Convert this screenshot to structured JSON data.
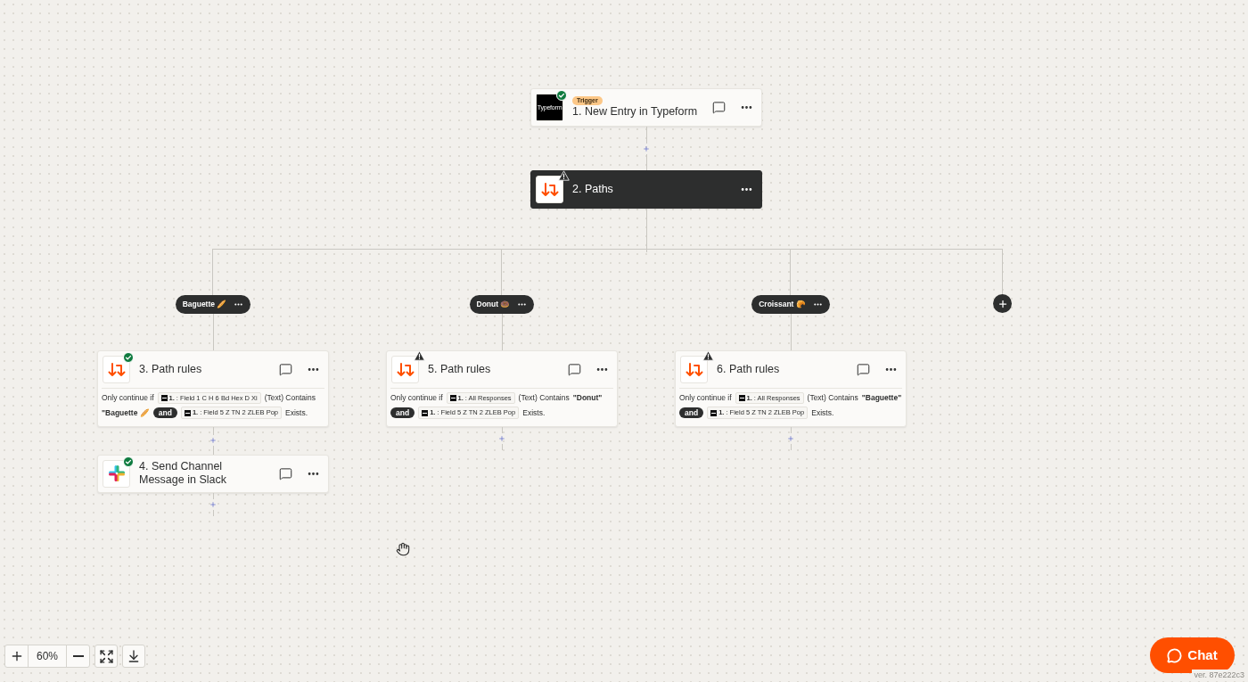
{
  "trigger": {
    "badge": "Trigger",
    "title": "1. New Entry in Typeform",
    "kind": "typeform",
    "logo_text": "Typeform",
    "complete": true,
    "selected": false
  },
  "paths_step": {
    "title": "2. Paths",
    "kind": "paths",
    "complete": false,
    "selected": true
  },
  "branches": [
    {
      "label": "Baguette 🥖",
      "steps": [
        {
          "title": "3. Path rules",
          "kind": "paths",
          "complete": true,
          "selected": false,
          "rule": [
            {
              "kind": "text",
              "text": "Only continue if"
            },
            {
              "kind": "field",
              "num": "1.",
              "text": ": Field 1 C H 6 Bd Hex D Xi"
            },
            {
              "kind": "text",
              "text": "(Text) Contains"
            },
            {
              "kind": "value",
              "text": "\"Baguette 🥖"
            },
            {
              "kind": "and",
              "text": "and"
            },
            {
              "kind": "field",
              "num": "1.",
              "text": ": Field 5 Z TN 2 ZLEB Pop"
            },
            {
              "kind": "text",
              "text": "Exists."
            }
          ]
        },
        {
          "title": "4. Send Channel Message in Slack",
          "kind": "slack",
          "complete": true,
          "selected": false
        }
      ]
    },
    {
      "label": "Donut 🍩",
      "steps": [
        {
          "title": "5. Path rules",
          "kind": "paths",
          "complete": false,
          "selected": false,
          "rule": [
            {
              "kind": "text",
              "text": "Only continue if"
            },
            {
              "kind": "field",
              "num": "1.",
              "text": ": All Responses"
            },
            {
              "kind": "text",
              "text": "(Text) Contains"
            },
            {
              "kind": "value",
              "text": "\"Donut\""
            },
            {
              "kind": "and",
              "text": "and"
            },
            {
              "kind": "field",
              "num": "1.",
              "text": ": Field 5 Z TN 2 ZLEB Pop"
            },
            {
              "kind": "text",
              "text": "Exists."
            }
          ]
        }
      ]
    },
    {
      "label": "Croissant 🥐",
      "steps": [
        {
          "title": "6. Path rules",
          "kind": "paths",
          "complete": false,
          "selected": false,
          "rule": [
            {
              "kind": "text",
              "text": "Only continue if"
            },
            {
              "kind": "field",
              "num": "1.",
              "text": ": All Responses"
            },
            {
              "kind": "text",
              "text": "(Text) Contains"
            },
            {
              "kind": "value",
              "text": "\"Baguette\""
            },
            {
              "kind": "and",
              "text": "and"
            },
            {
              "kind": "field",
              "num": "1.",
              "text": ": Field 5 Z TN 2 ZLEB Pop"
            },
            {
              "kind": "text",
              "text": "Exists."
            }
          ]
        }
      ]
    }
  ],
  "zoom": {
    "value": "60%"
  },
  "chat_button": "Chat",
  "version": "ver. 87e222c3"
}
